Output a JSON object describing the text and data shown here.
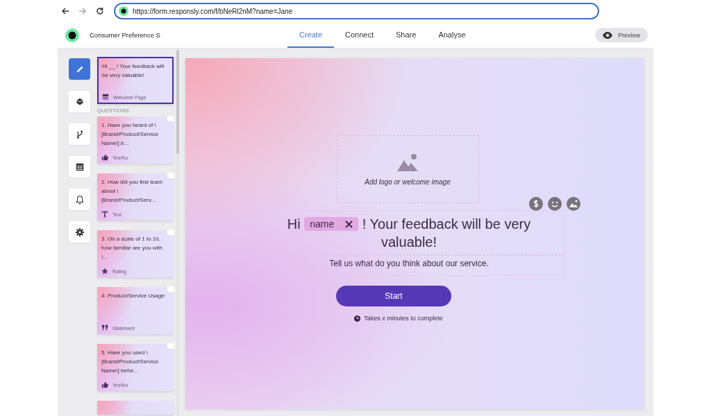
{
  "browser": {
    "url": "https://form.responsly.com/f/bNeRl2nM?name=Jane"
  },
  "app_header": {
    "form_title": "Consumer Preference S",
    "tabs": [
      {
        "label": "Create",
        "selected": true
      },
      {
        "label": "Connect",
        "selected": false
      },
      {
        "label": "Share",
        "selected": false
      },
      {
        "label": "Analyse",
        "selected": false
      }
    ],
    "preview_button": "Preview"
  },
  "tool_rail": [
    {
      "kind": "edit",
      "selected": true
    },
    {
      "kind": "theme",
      "selected": false
    },
    {
      "kind": "logic",
      "selected": false
    },
    {
      "kind": "calculator",
      "selected": false
    },
    {
      "kind": "notifications",
      "selected": false
    },
    {
      "kind": "settings",
      "selected": false
    }
  ],
  "welcome_card": {
    "text": "Hi __ ! Your feedback will be very valuable!",
    "type_label": "Welcome Page",
    "selected": true
  },
  "questions_heading": "QUESTIONS",
  "questions": [
    {
      "text": "1. Have you heard of \\[Brand/Product/Service Name\\] b...",
      "kind": "yes_no",
      "type_label": "Yes/No",
      "selected": false
    },
    {
      "text": "2. How did you first learn about \\[Brand/Product/Serv...",
      "kind": "text",
      "type_label": "Text",
      "selected": false
    },
    {
      "text": "3. On a scale of 1 to 10, how familiar are you with \\...",
      "kind": "rating",
      "type_label": "Rating",
      "selected": false
    },
    {
      "text": "4. Product/Service Usage:",
      "kind": "statement",
      "type_label": "Statement",
      "selected": false
    },
    {
      "text": "5. Have you used \\[Brand/Product/Service Name\\] befor...",
      "kind": "yes_no",
      "type_label": "Yes/No",
      "selected": false
    }
  ],
  "canvas": {
    "image_placeholder": "Add logo or welcome image",
    "heading_prefix": "Hi",
    "name_tag": "name",
    "heading_suffix": "! Your feedback will be very valuable!",
    "subtitle": "Tell us what do you think about our service.",
    "start_button": "Start",
    "time_note": "Takes x minutes to complete"
  }
}
